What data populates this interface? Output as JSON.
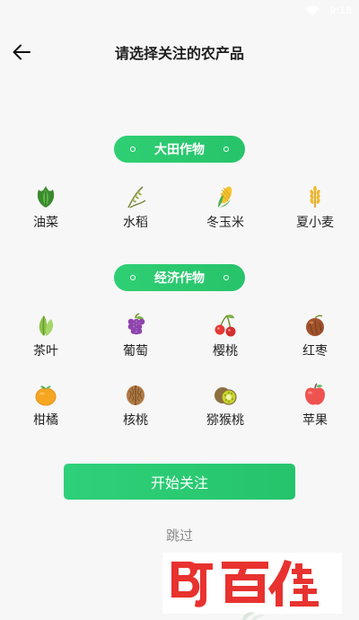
{
  "status_bar": {
    "time": "9:18",
    "icons": [
      "wifi-icon"
    ]
  },
  "header": {
    "title": "请选择关注的农产品",
    "back_icon": "arrow-left-icon"
  },
  "sections": [
    {
      "title": "大田作物",
      "items": [
        {
          "label": "油菜",
          "icon": "rapeseed-icon"
        },
        {
          "label": "水稻",
          "icon": "rice-icon"
        },
        {
          "label": "冬玉米",
          "icon": "corn-icon"
        },
        {
          "label": "夏小麦",
          "icon": "wheat-icon"
        }
      ]
    },
    {
      "title": "经济作物",
      "items": [
        {
          "label": "茶叶",
          "icon": "tea-icon"
        },
        {
          "label": "葡萄",
          "icon": "grape-icon"
        },
        {
          "label": "樱桃",
          "icon": "cherry-icon"
        },
        {
          "label": "红枣",
          "icon": "jujube-icon"
        },
        {
          "label": "柑橘",
          "icon": "orange-icon"
        },
        {
          "label": "核桃",
          "icon": "walnut-icon"
        },
        {
          "label": "猕猴桃",
          "icon": "kiwi-icon"
        },
        {
          "label": "苹果",
          "icon": "apple-icon"
        }
      ]
    }
  ],
  "actions": {
    "start": "开始关注",
    "skip": "跳过"
  },
  "watermark": {
    "text": "百佳"
  },
  "colors": {
    "accent": "#2ecc71",
    "watermark": "#e8322f"
  }
}
